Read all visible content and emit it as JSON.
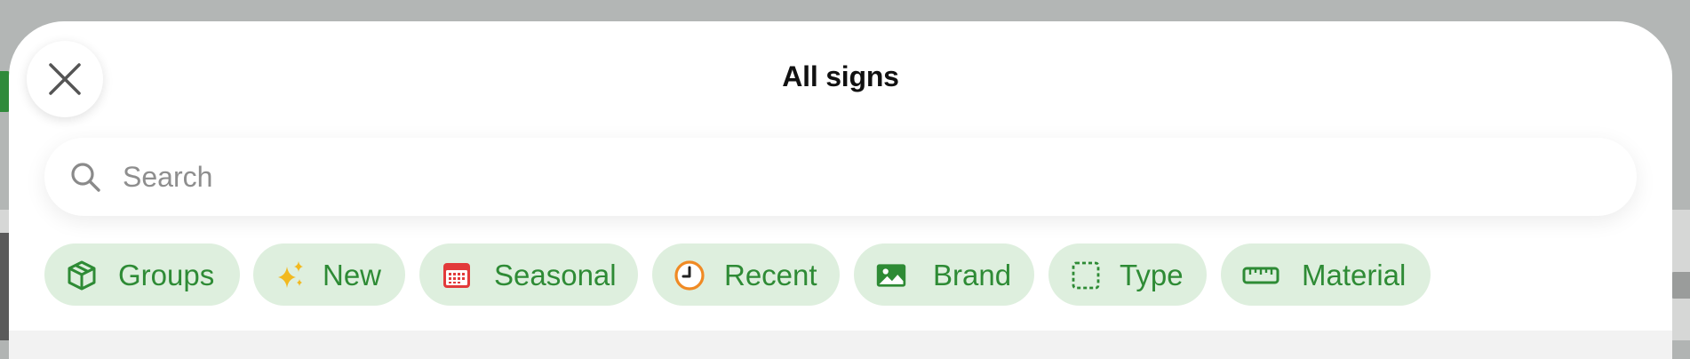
{
  "sheet": {
    "title": "All signs",
    "close_icon": "close-icon"
  },
  "search": {
    "placeholder": "Search",
    "value": "",
    "icon": "search-icon"
  },
  "filters": [
    {
      "label": "Groups",
      "icon": "cube-icon"
    },
    {
      "label": "New",
      "icon": "sparkles-icon"
    },
    {
      "label": "Seasonal",
      "icon": "calendar-icon"
    },
    {
      "label": "Recent",
      "icon": "clock-icon"
    },
    {
      "label": "Brand",
      "icon": "image-icon"
    },
    {
      "label": "Type",
      "icon": "dashed-square-icon"
    },
    {
      "label": "Material",
      "icon": "ruler-icon"
    }
  ],
  "colors": {
    "chip_background": "#deefde",
    "chip_text": "#2e8b35",
    "sparkle": "#f2b91f",
    "calendar": "#e23a3a",
    "clock": "#f08a24"
  }
}
